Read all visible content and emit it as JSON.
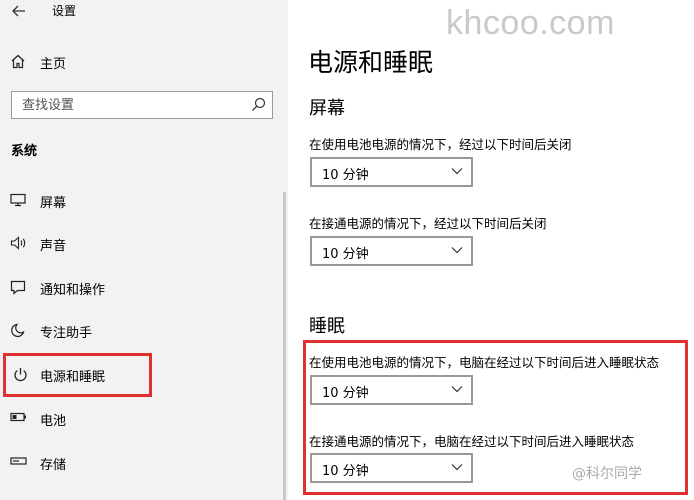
{
  "header": {
    "back_icon": "back-arrow-icon",
    "title": "设置"
  },
  "sidebar": {
    "home": {
      "icon": "home-icon",
      "label": "主页"
    },
    "search": {
      "placeholder": "查找设置",
      "icon": "search-icon"
    },
    "section": "系统",
    "items": [
      {
        "icon": "display-icon",
        "label": "屏幕"
      },
      {
        "icon": "speaker-icon",
        "label": "声音"
      },
      {
        "icon": "notification-icon",
        "label": "通知和操作"
      },
      {
        "icon": "moon-icon",
        "label": "专注助手"
      },
      {
        "icon": "power-icon",
        "label": "电源和睡眠",
        "selected": true
      },
      {
        "icon": "battery-icon",
        "label": "电池"
      },
      {
        "icon": "storage-icon",
        "label": "存储"
      }
    ]
  },
  "main": {
    "title": "电源和睡眠",
    "screen_group": {
      "heading": "屏幕",
      "battery_label": "在使用电池电源的情况下，经过以下时间后关闭",
      "battery_value": "10 分钟",
      "plugged_label": "在接通电源的情况下，经过以下时间后关闭",
      "plugged_value": "10 分钟"
    },
    "sleep_group": {
      "heading": "睡眠",
      "battery_label": "在使用电池电源的情况下，电脑在经过以下时间后进入睡眠状态",
      "battery_value": "10 分钟",
      "plugged_label": "在接通电源的情况下，电脑在经过以下时间后进入睡眠状态",
      "plugged_value": "10 分钟"
    }
  },
  "watermarks": {
    "top": "khcoo.com",
    "bottom": "@科尔同学"
  },
  "colors": {
    "sidebar_bg": "#f2f2f2",
    "highlight": "#e03131",
    "dropdown_border": "#999999"
  }
}
